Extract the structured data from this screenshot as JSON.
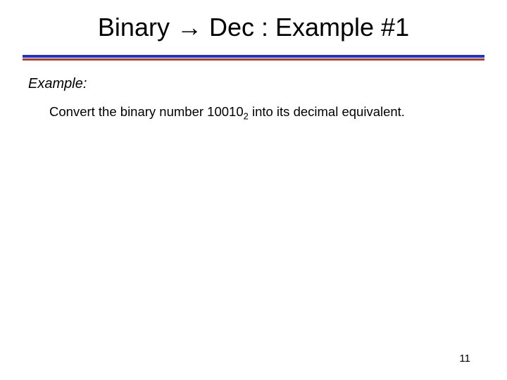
{
  "title": "Binary → Dec : Example #1",
  "example_label": "Example:",
  "body": {
    "pre": "Convert the binary number 10010",
    "sub": "2",
    "post": " into its decimal equivalent."
  },
  "page_number": "11"
}
